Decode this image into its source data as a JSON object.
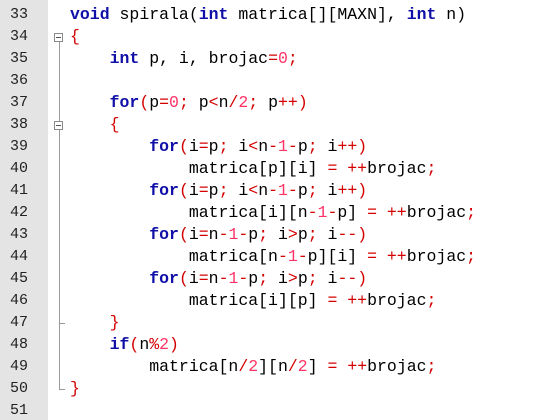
{
  "editor": {
    "lines": [
      {
        "n": "33",
        "indent": "",
        "tokens": [
          {
            "t": "kw",
            "v": "void"
          },
          {
            "t": "txt",
            "v": " spirala("
          },
          {
            "t": "kw",
            "v": "int"
          },
          {
            "t": "txt",
            "v": " matrica[][MAXN], "
          },
          {
            "t": "kw",
            "v": "int"
          },
          {
            "t": "txt",
            "v": " n)"
          }
        ]
      },
      {
        "n": "34",
        "indent": "",
        "tokens": [
          {
            "t": "op",
            "v": "{"
          }
        ]
      },
      {
        "n": "35",
        "indent": "    ",
        "tokens": [
          {
            "t": "kw",
            "v": "int"
          },
          {
            "t": "txt",
            "v": " p, i, brojac"
          },
          {
            "t": "op",
            "v": "="
          },
          {
            "t": "num",
            "v": "0"
          },
          {
            "t": "op",
            "v": ";"
          }
        ]
      },
      {
        "n": "36",
        "indent": "",
        "tokens": []
      },
      {
        "n": "37",
        "indent": "    ",
        "tokens": [
          {
            "t": "kw",
            "v": "for"
          },
          {
            "t": "op",
            "v": "("
          },
          {
            "t": "txt",
            "v": "p"
          },
          {
            "t": "op",
            "v": "="
          },
          {
            "t": "num",
            "v": "0"
          },
          {
            "t": "op",
            "v": ";"
          },
          {
            "t": "txt",
            "v": " p"
          },
          {
            "t": "op",
            "v": "<"
          },
          {
            "t": "txt",
            "v": "n"
          },
          {
            "t": "op",
            "v": "/"
          },
          {
            "t": "num",
            "v": "2"
          },
          {
            "t": "op",
            "v": ";"
          },
          {
            "t": "txt",
            "v": " p"
          },
          {
            "t": "op",
            "v": "++)"
          }
        ]
      },
      {
        "n": "38",
        "indent": "    ",
        "tokens": [
          {
            "t": "op",
            "v": "{"
          }
        ]
      },
      {
        "n": "39",
        "indent": "        ",
        "tokens": [
          {
            "t": "kw",
            "v": "for"
          },
          {
            "t": "op",
            "v": "("
          },
          {
            "t": "txt",
            "v": "i"
          },
          {
            "t": "op",
            "v": "="
          },
          {
            "t": "txt",
            "v": "p"
          },
          {
            "t": "op",
            "v": ";"
          },
          {
            "t": "txt",
            "v": " i"
          },
          {
            "t": "op",
            "v": "<"
          },
          {
            "t": "txt",
            "v": "n"
          },
          {
            "t": "op",
            "v": "-"
          },
          {
            "t": "num",
            "v": "1"
          },
          {
            "t": "op",
            "v": "-"
          },
          {
            "t": "txt",
            "v": "p"
          },
          {
            "t": "op",
            "v": ";"
          },
          {
            "t": "txt",
            "v": " i"
          },
          {
            "t": "op",
            "v": "++)"
          }
        ]
      },
      {
        "n": "40",
        "indent": "            ",
        "tokens": [
          {
            "t": "txt",
            "v": "matrica[p][i] "
          },
          {
            "t": "op",
            "v": "="
          },
          {
            "t": "txt",
            "v": " "
          },
          {
            "t": "op",
            "v": "++"
          },
          {
            "t": "txt",
            "v": "brojac"
          },
          {
            "t": "op",
            "v": ";"
          }
        ]
      },
      {
        "n": "41",
        "indent": "        ",
        "tokens": [
          {
            "t": "kw",
            "v": "for"
          },
          {
            "t": "op",
            "v": "("
          },
          {
            "t": "txt",
            "v": "i"
          },
          {
            "t": "op",
            "v": "="
          },
          {
            "t": "txt",
            "v": "p"
          },
          {
            "t": "op",
            "v": ";"
          },
          {
            "t": "txt",
            "v": " i"
          },
          {
            "t": "op",
            "v": "<"
          },
          {
            "t": "txt",
            "v": "n"
          },
          {
            "t": "op",
            "v": "-"
          },
          {
            "t": "num",
            "v": "1"
          },
          {
            "t": "op",
            "v": "-"
          },
          {
            "t": "txt",
            "v": "p"
          },
          {
            "t": "op",
            "v": ";"
          },
          {
            "t": "txt",
            "v": " i"
          },
          {
            "t": "op",
            "v": "++)"
          }
        ]
      },
      {
        "n": "42",
        "indent": "            ",
        "tokens": [
          {
            "t": "txt",
            "v": "matrica[i][n"
          },
          {
            "t": "op",
            "v": "-"
          },
          {
            "t": "num",
            "v": "1"
          },
          {
            "t": "op",
            "v": "-"
          },
          {
            "t": "txt",
            "v": "p] "
          },
          {
            "t": "op",
            "v": "="
          },
          {
            "t": "txt",
            "v": " "
          },
          {
            "t": "op",
            "v": "++"
          },
          {
            "t": "txt",
            "v": "brojac"
          },
          {
            "t": "op",
            "v": ";"
          }
        ]
      },
      {
        "n": "43",
        "indent": "        ",
        "tokens": [
          {
            "t": "kw",
            "v": "for"
          },
          {
            "t": "op",
            "v": "("
          },
          {
            "t": "txt",
            "v": "i"
          },
          {
            "t": "op",
            "v": "="
          },
          {
            "t": "txt",
            "v": "n"
          },
          {
            "t": "op",
            "v": "-"
          },
          {
            "t": "num",
            "v": "1"
          },
          {
            "t": "op",
            "v": "-"
          },
          {
            "t": "txt",
            "v": "p"
          },
          {
            "t": "op",
            "v": ";"
          },
          {
            "t": "txt",
            "v": " i"
          },
          {
            "t": "op",
            "v": ">"
          },
          {
            "t": "txt",
            "v": "p"
          },
          {
            "t": "op",
            "v": ";"
          },
          {
            "t": "txt",
            "v": " i"
          },
          {
            "t": "op",
            "v": "--)"
          }
        ]
      },
      {
        "n": "44",
        "indent": "            ",
        "tokens": [
          {
            "t": "txt",
            "v": "matrica[n"
          },
          {
            "t": "op",
            "v": "-"
          },
          {
            "t": "num",
            "v": "1"
          },
          {
            "t": "op",
            "v": "-"
          },
          {
            "t": "txt",
            "v": "p][i] "
          },
          {
            "t": "op",
            "v": "="
          },
          {
            "t": "txt",
            "v": " "
          },
          {
            "t": "op",
            "v": "++"
          },
          {
            "t": "txt",
            "v": "brojac"
          },
          {
            "t": "op",
            "v": ";"
          }
        ]
      },
      {
        "n": "45",
        "indent": "        ",
        "tokens": [
          {
            "t": "kw",
            "v": "for"
          },
          {
            "t": "op",
            "v": "("
          },
          {
            "t": "txt",
            "v": "i"
          },
          {
            "t": "op",
            "v": "="
          },
          {
            "t": "txt",
            "v": "n"
          },
          {
            "t": "op",
            "v": "-"
          },
          {
            "t": "num",
            "v": "1"
          },
          {
            "t": "op",
            "v": "-"
          },
          {
            "t": "txt",
            "v": "p"
          },
          {
            "t": "op",
            "v": ";"
          },
          {
            "t": "txt",
            "v": " i"
          },
          {
            "t": "op",
            "v": ">"
          },
          {
            "t": "txt",
            "v": "p"
          },
          {
            "t": "op",
            "v": ";"
          },
          {
            "t": "txt",
            "v": " i"
          },
          {
            "t": "op",
            "v": "--)"
          }
        ]
      },
      {
        "n": "46",
        "indent": "            ",
        "tokens": [
          {
            "t": "txt",
            "v": "matrica[i][p] "
          },
          {
            "t": "op",
            "v": "="
          },
          {
            "t": "txt",
            "v": " "
          },
          {
            "t": "op",
            "v": "++"
          },
          {
            "t": "txt",
            "v": "brojac"
          },
          {
            "t": "op",
            "v": ";"
          }
        ]
      },
      {
        "n": "47",
        "indent": "    ",
        "tokens": [
          {
            "t": "op",
            "v": "}"
          }
        ]
      },
      {
        "n": "48",
        "indent": "    ",
        "tokens": [
          {
            "t": "kw",
            "v": "if"
          },
          {
            "t": "op",
            "v": "("
          },
          {
            "t": "txt",
            "v": "n"
          },
          {
            "t": "op",
            "v": "%"
          },
          {
            "t": "num",
            "v": "2"
          },
          {
            "t": "op",
            "v": ")"
          }
        ]
      },
      {
        "n": "49",
        "indent": "        ",
        "tokens": [
          {
            "t": "txt",
            "v": "matrica[n"
          },
          {
            "t": "op",
            "v": "/"
          },
          {
            "t": "num",
            "v": "2"
          },
          {
            "t": "txt",
            "v": "][n"
          },
          {
            "t": "op",
            "v": "/"
          },
          {
            "t": "num",
            "v": "2"
          },
          {
            "t": "txt",
            "v": "] "
          },
          {
            "t": "op",
            "v": "="
          },
          {
            "t": "txt",
            "v": " "
          },
          {
            "t": "op",
            "v": "++"
          },
          {
            "t": "txt",
            "v": "brojac"
          },
          {
            "t": "op",
            "v": ";"
          }
        ]
      },
      {
        "n": "50",
        "indent": "",
        "tokens": [
          {
            "t": "op",
            "v": "}"
          }
        ]
      },
      {
        "n": "51",
        "indent": "",
        "tokens": []
      }
    ],
    "folds": [
      {
        "open_line": 1,
        "close_line": 17,
        "name": "fold-function-body"
      },
      {
        "open_line": 5,
        "close_line": 14,
        "name": "fold-for-loop-body"
      }
    ],
    "colors": {
      "keyword": "#1010a8",
      "operator": "#d40000",
      "number": "#ff3366",
      "text": "#000000",
      "gutter": "#e4e4e4"
    }
  }
}
